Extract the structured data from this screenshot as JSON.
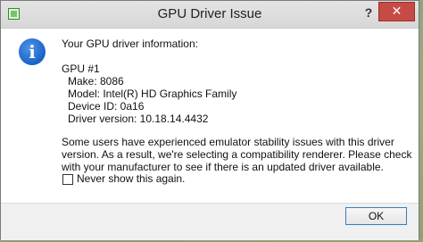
{
  "window": {
    "title": "GPU Driver Issue",
    "help_glyph": "?",
    "close_glyph": "✕"
  },
  "message": {
    "heading": "Your GPU driver information:",
    "gpu_label": "GPU #1",
    "make": "Make: 8086",
    "model": "Model: Intel(R) HD Graphics Family",
    "device_id": "Device ID: 0a16",
    "driver_version": "Driver version: 10.18.14.4432",
    "body": "Some users have experienced emulator stability issues with this driver version.  As a result, we're selecting a compatibility renderer.  Please check with your manufacturer to see if there is an updated driver available."
  },
  "checkbox": {
    "label": "Never show this again.",
    "checked": false
  },
  "buttons": {
    "ok": "OK"
  },
  "icons": {
    "app": "app-icon",
    "info": "info-icon",
    "help": "help-icon",
    "close": "close-icon"
  },
  "colors": {
    "close_button": "#c74b45",
    "info_icon": "#1a62c8",
    "ok_border": "#3c7fb1"
  }
}
